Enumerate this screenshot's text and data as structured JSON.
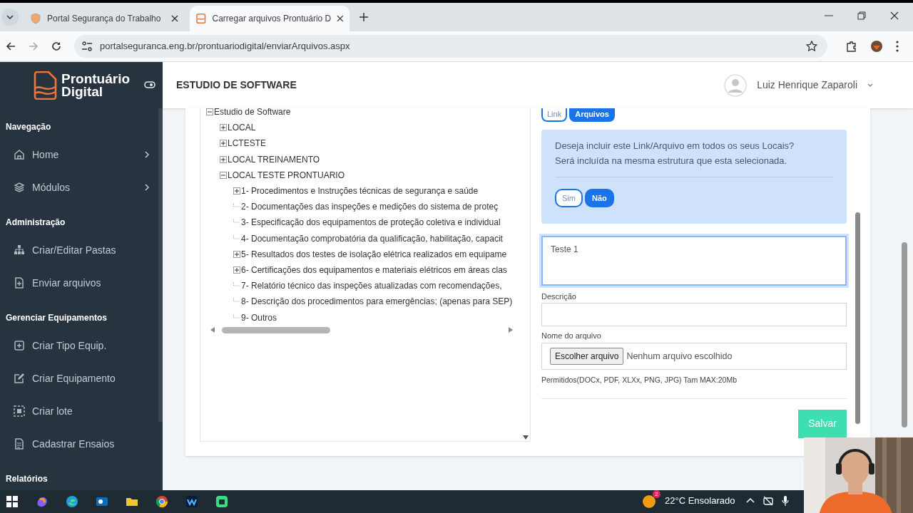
{
  "browser": {
    "tabs": [
      {
        "title": "Portal Segurança do Trabalho",
        "selected": false
      },
      {
        "title": "Carregar arquivos Prontuário D",
        "selected": true
      }
    ],
    "url": "portalseguranca.eng.br/prontuariodigital/enviarArquivos.aspx"
  },
  "sidebar": {
    "logo": [
      "Prontuário",
      "Digital"
    ],
    "sections": [
      {
        "heading": "Navegação",
        "items": [
          {
            "label": "Home",
            "has_submenu": true
          },
          {
            "label": "Módulos",
            "has_submenu": true
          }
        ]
      },
      {
        "heading": "Administração",
        "items": [
          {
            "label": "Criar/Editar Pastas",
            "has_submenu": false
          },
          {
            "label": "Enviar arquivos",
            "has_submenu": false
          }
        ]
      },
      {
        "heading": "Gerenciar Equipamentos",
        "items": [
          {
            "label": "Criar Tipo Equip.",
            "has_submenu": false
          },
          {
            "label": "Criar Equipamento",
            "has_submenu": false
          },
          {
            "label": "Criar lote",
            "has_submenu": false
          },
          {
            "label": "Cadastrar Ensaios",
            "has_submenu": false
          }
        ]
      },
      {
        "heading": "Relatórios"
      }
    ]
  },
  "header": {
    "title": "ESTUDIO DE SOFTWARE",
    "user": "Luiz Henrique Zaparoli"
  },
  "tree": [
    {
      "label": "Estudio de Software",
      "kind": "branch",
      "expanded": true,
      "children": [
        {
          "label": "LOCAL",
          "kind": "branch",
          "expanded": false
        },
        {
          "label": "LCTESTE",
          "kind": "branch",
          "expanded": false
        },
        {
          "label": "LOCAL TREINAMENTO",
          "kind": "branch",
          "expanded": false
        },
        {
          "label": "LOCAL TESTE PRONTUARIO",
          "kind": "branch",
          "expanded": true,
          "children": [
            {
              "label": "1- Procedimentos e Instruções técnicas de segurança e saúde",
              "kind": "branch",
              "expanded": false
            },
            {
              "label": "2- Documentações das inspeções e medições do sistema de proteç",
              "kind": "leaf"
            },
            {
              "label": "3- Especificação dos equipamentos de proteção coletiva e individual",
              "kind": "leaf"
            },
            {
              "label": "4- Documentação comprobatória da qualificação, habilitação, capacit",
              "kind": "leaf"
            },
            {
              "label": "5- Resultados dos testes de isolação elétrica realizados em equipame",
              "kind": "branch",
              "expanded": false
            },
            {
              "label": "6- Certificações dos equipamentos e materiais elétricos em áreas clas",
              "kind": "branch",
              "expanded": false
            },
            {
              "label": "7- Relatório técnico das inspeções atualizadas com recomendações,",
              "kind": "leaf"
            },
            {
              "label": "8- Descrição dos procedimentos para emergências; (apenas para SEP)",
              "kind": "leaf"
            },
            {
              "label": "9- Outros",
              "kind": "leaf"
            }
          ]
        }
      ]
    }
  ],
  "form": {
    "modes": [
      {
        "label": "Link",
        "selected": false
      },
      {
        "label": "Arquivos",
        "selected": true
      }
    ],
    "alert": [
      "Deseja incluir este Link/Arquivo em todos os seus Locais?",
      "Será incluída na mesma estrutura que esta selecionada."
    ],
    "choices": [
      {
        "label": "Sim",
        "selected": false
      },
      {
        "label": "Não",
        "selected": true
      }
    ],
    "title_field": {
      "value": "Teste 1",
      "focused": true
    },
    "description": {
      "label": "Descrição"
    },
    "file": {
      "label": "Nome do arquivo",
      "button": "Escolher arquivo",
      "status": "Nenhum arquivo escolhido"
    },
    "hint": "Permitidos(DOCx, PDF, XLXx, PNG, JPG) Tam MAX:20Mb",
    "save": "Salvar"
  },
  "taskbar": {
    "weather": "22°C Ensolarado",
    "badge": "2"
  }
}
